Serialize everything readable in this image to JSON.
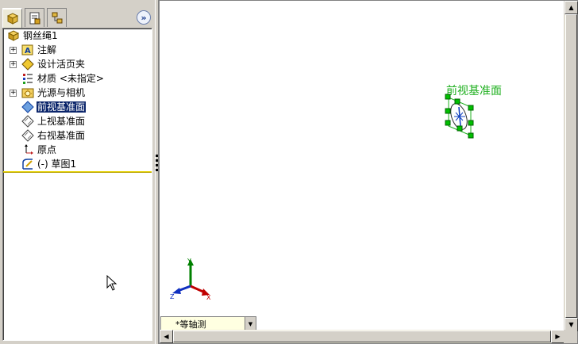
{
  "feature_manager": {
    "tabs": [
      {
        "name": "feature-tree",
        "icon": "feature-tree-icon"
      },
      {
        "name": "property",
        "icon": "property-manager-icon"
      },
      {
        "name": "configuration",
        "icon": "configuration-icon"
      }
    ],
    "expand_symbol": "»",
    "root": {
      "label": "钢丝绳1",
      "icon": "part-icon"
    },
    "items": [
      {
        "label": "注解",
        "icon": "annotations-icon",
        "expander": "+"
      },
      {
        "label": "设计活页夹",
        "icon": "design-binder-icon",
        "expander": "+"
      },
      {
        "label": "材质 <未指定>",
        "icon": "material-icon",
        "expander": ""
      },
      {
        "label": "光源与相机",
        "icon": "lights-cameras-icon",
        "expander": "+"
      },
      {
        "label": "前视基准面",
        "icon": "plane-icon",
        "expander": "",
        "selected": true
      },
      {
        "label": "上视基准面",
        "icon": "plane-icon",
        "expander": ""
      },
      {
        "label": "右视基准面",
        "icon": "plane-icon",
        "expander": ""
      },
      {
        "label": "原点",
        "icon": "origin-icon",
        "expander": ""
      },
      {
        "label": "(-)  草图1",
        "icon": "sketch-icon",
        "expander": ""
      }
    ]
  },
  "graphics": {
    "plane_label": "前视基准面",
    "plane_label_color": "#20b020",
    "triad": {
      "x": "X",
      "y": "Y",
      "z": "Z"
    },
    "view_orientation": {
      "value": "*等轴测"
    }
  },
  "colors": {
    "selection": "#0a246a",
    "rollback_bar": "#e8d300",
    "handle_green": "#00c000"
  }
}
